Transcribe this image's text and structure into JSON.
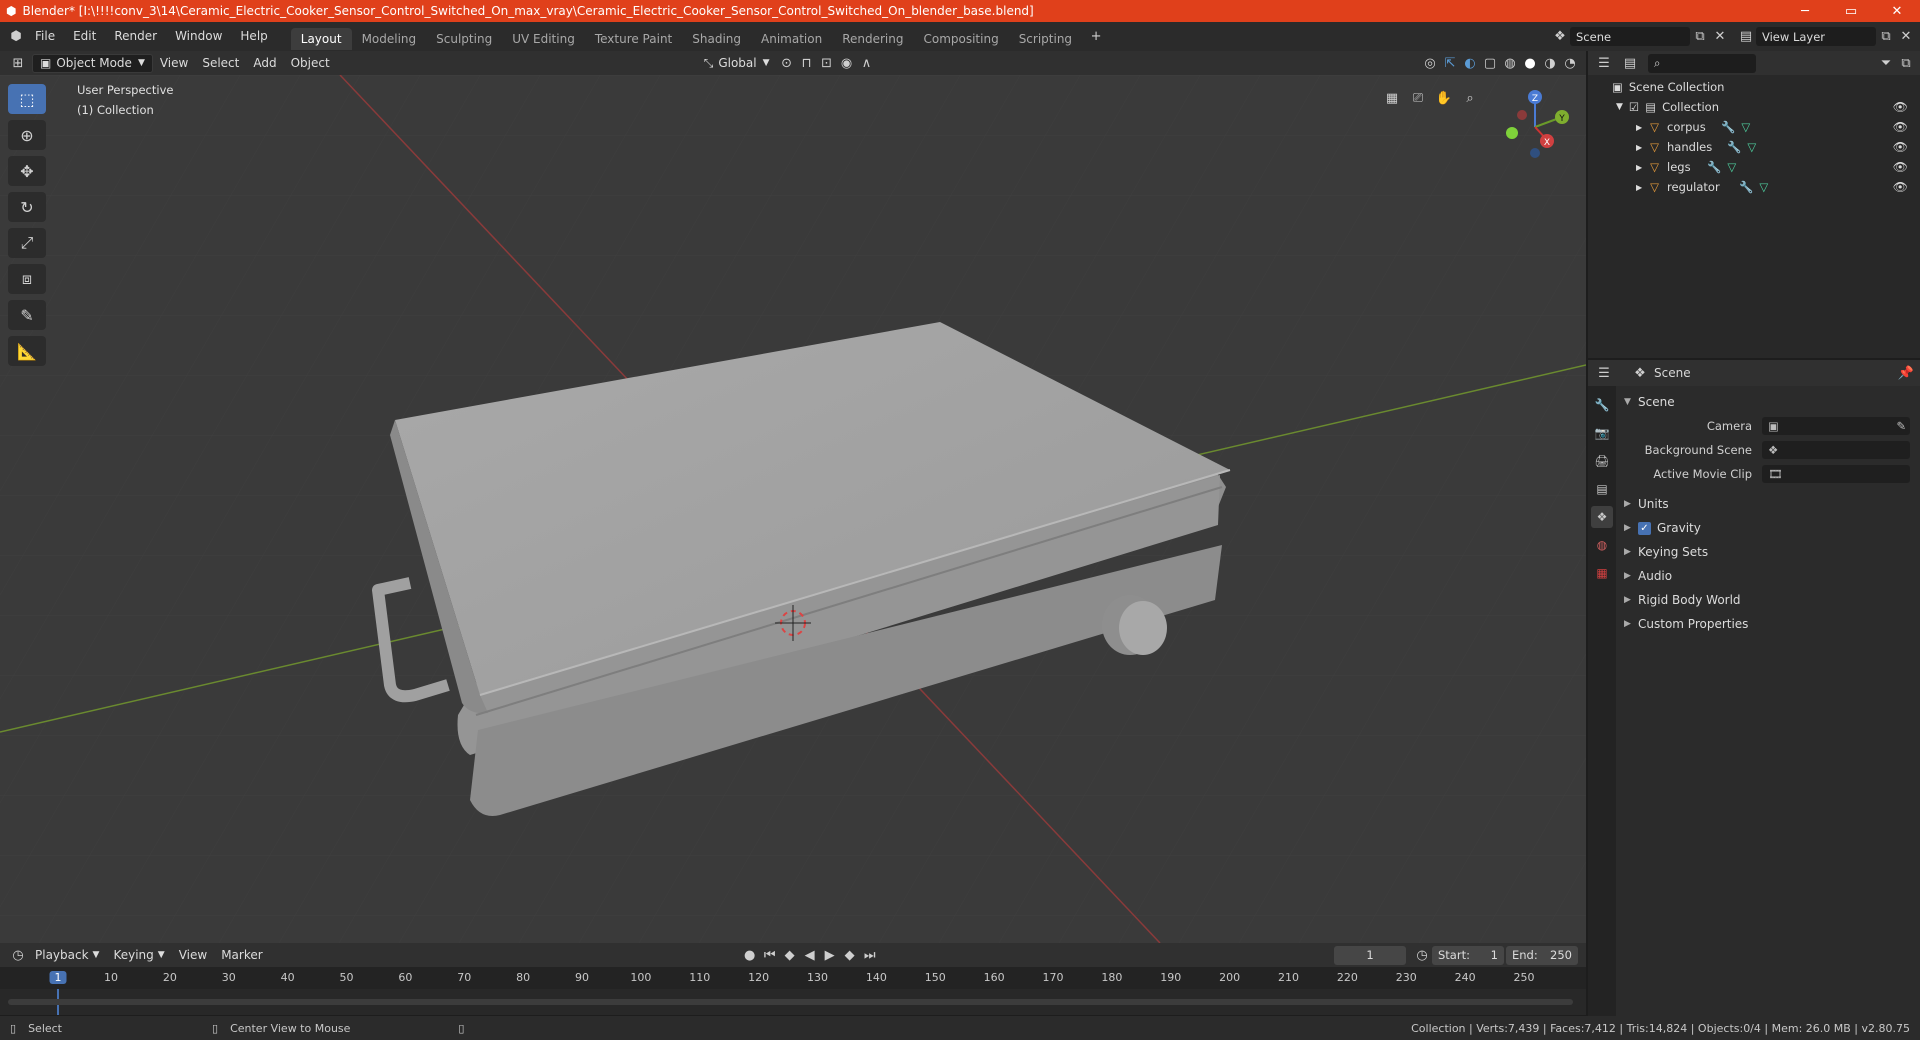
{
  "titlebar": {
    "title": "Blender* [I:\\!!!!conv_3\\14\\Ceramic_Electric_Cooker_Sensor_Control_Switched_On_max_vray\\Ceramic_Electric_Cooker_Sensor_Control_Switched_On_blender_base.blend]",
    "minimize": "─",
    "maximize": "▭",
    "close": "✕"
  },
  "menu": {
    "file": "File",
    "edit": "Edit",
    "render": "Render",
    "window": "Window",
    "help": "Help"
  },
  "workspaces": [
    "Layout",
    "Modeling",
    "Sculpting",
    "UV Editing",
    "Texture Paint",
    "Shading",
    "Animation",
    "Rendering",
    "Compositing",
    "Scripting"
  ],
  "scene_field": "Scene",
  "view_layer_field": "View Layer",
  "viewport_header": {
    "mode": "Object Mode",
    "view": "View",
    "select": "Select",
    "add": "Add",
    "object": "Object",
    "orientation": "Global"
  },
  "viewport": {
    "perspective_label": "User Perspective",
    "collection_label": "(1) Collection",
    "gizmo": {
      "x": "X",
      "y": "Y",
      "z": "Z"
    }
  },
  "outliner": {
    "root": "Scene Collection",
    "collection": "Collection",
    "objects": [
      {
        "name": "corpus"
      },
      {
        "name": "handles"
      },
      {
        "name": "legs"
      },
      {
        "name": "regulator"
      }
    ]
  },
  "properties": {
    "header": "Scene",
    "section": "Scene",
    "camera_label": "Camera",
    "background_scene_label": "Background Scene",
    "active_movie_clip_label": "Active Movie Clip",
    "subsections": [
      "Units",
      "Gravity",
      "Keying Sets",
      "Audio",
      "Rigid Body World",
      "Custom Properties"
    ],
    "gravity_checked": true
  },
  "timeline": {
    "playback": "Playback",
    "keying": "Keying",
    "view": "View",
    "marker": "Marker",
    "current_frame": "1",
    "start_label": "Start:",
    "start_value": "1",
    "end_label": "End:",
    "end_value": "250",
    "ruler_ticks": [
      "1",
      "10",
      "20",
      "30",
      "40",
      "50",
      "60",
      "70",
      "80",
      "90",
      "100",
      "110",
      "120",
      "130",
      "140",
      "150",
      "160",
      "170",
      "180",
      "190",
      "200",
      "210",
      "220",
      "230",
      "240",
      "250"
    ]
  },
  "statusbar": {
    "select": "Select",
    "center_view": "Center View to Mouse",
    "stats": "Collection | Verts:7,439 | Faces:7,412 | Tris:14,824 | Objects:0/4 | Mem: 26.0 MB | v2.80.75"
  }
}
